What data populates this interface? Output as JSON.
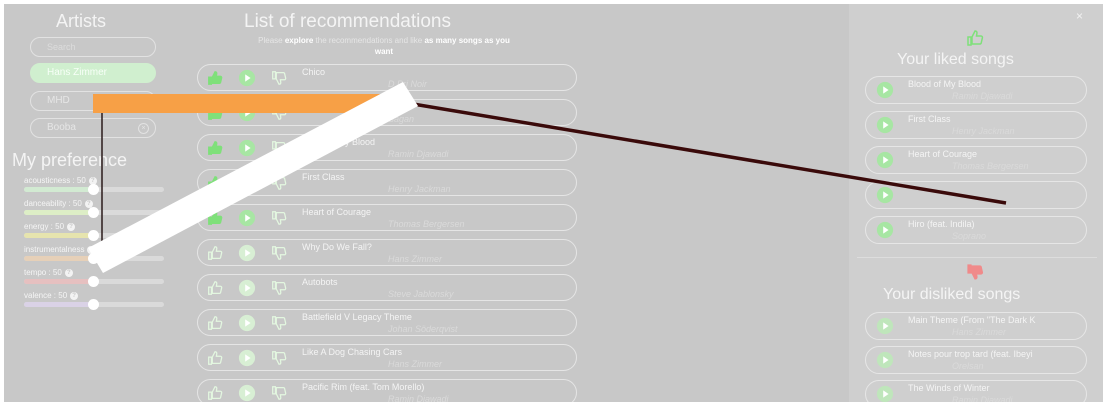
{
  "artists": {
    "title": "Artists",
    "search_placeholder": "Search",
    "selected": [
      "Hans Zimmer",
      "MHD",
      "Booba"
    ],
    "remove_glyph": "×"
  },
  "preferences": {
    "title": "My preference",
    "help_glyph": "?",
    "sliders": [
      {
        "label": "acousticness : 50",
        "value": 50,
        "color": "#d2ead2"
      },
      {
        "label": "danceability : 50",
        "value": 50,
        "color": "#ddeec6"
      },
      {
        "label": "energy : 50",
        "value": 50,
        "color": "#e6e4ae"
      },
      {
        "label": "instrumentalness",
        "value": 50,
        "color": "#e6d0b8"
      },
      {
        "label": "tempo : 50",
        "value": 50,
        "color": "#e6c0c0"
      },
      {
        "label": "valence : 50",
        "value": 50,
        "color": "#dad2e6"
      }
    ]
  },
  "recommendations": {
    "title": "List of recommendations",
    "instruction_pre": "Please ",
    "instruction_bold1": "explore",
    "instruction_mid": " the recommendations and like ",
    "instruction_bold2": "as many songs as you want",
    "songs": [
      {
        "title": "Chico",
        "artist": "D.Pri Noir",
        "liked": true
      },
      {
        "title": "",
        "artist": "Sagan",
        "liked": true
      },
      {
        "title": "Blood of My Blood",
        "artist": "Ramin Djawadi",
        "liked": true
      },
      {
        "title": "First Class",
        "artist": "Henry Jackman",
        "liked": true
      },
      {
        "title": "Heart of Courage",
        "artist": "Thomas Bergersen",
        "liked": true
      },
      {
        "title": "Why Do We Fall?",
        "artist": "Hans Zimmer",
        "liked": false
      },
      {
        "title": "Autobots",
        "artist": "Steve Jablonsky",
        "liked": false
      },
      {
        "title": "Battlefield V Legacy Theme",
        "artist": "Johan Söderqvist",
        "liked": false
      },
      {
        "title": "Like A Dog Chasing Cars",
        "artist": "Hans Zimmer",
        "liked": false
      },
      {
        "title": "Pacific Rim (feat. Tom Morello)",
        "artist": "Ramin Djawadi",
        "liked": false
      }
    ]
  },
  "liked_panel": {
    "close_glyph": "×",
    "title": "Your liked songs",
    "songs": [
      {
        "title": "Blood of My Blood",
        "artist": "Ramin Djawadi"
      },
      {
        "title": "First Class",
        "artist": "Henry Jackman"
      },
      {
        "title": "Heart of Courage",
        "artist": "Thomas Bergersen"
      },
      {
        "title": "",
        "artist": ""
      },
      {
        "title": "Hiro (feat. Indila)",
        "artist": "Soprano"
      }
    ]
  },
  "disliked_panel": {
    "title": "Your disliked songs",
    "songs": [
      {
        "title": "Main Theme (From \"The Dark K",
        "artist": "Hans Zimmer"
      },
      {
        "title": "Notes pour trop tard (feat. Ibeyi",
        "artist": "Orelsan"
      },
      {
        "title": "The Winds of Winter",
        "artist": "Ramin Djawadi"
      }
    ]
  },
  "colors": {
    "background": "#c8c8c8",
    "liked_green": "#7fe07a",
    "highlight_orange": "#f7a046",
    "arrow_dark": "#3a0a0a",
    "disliked_red": "#f08a8a"
  }
}
